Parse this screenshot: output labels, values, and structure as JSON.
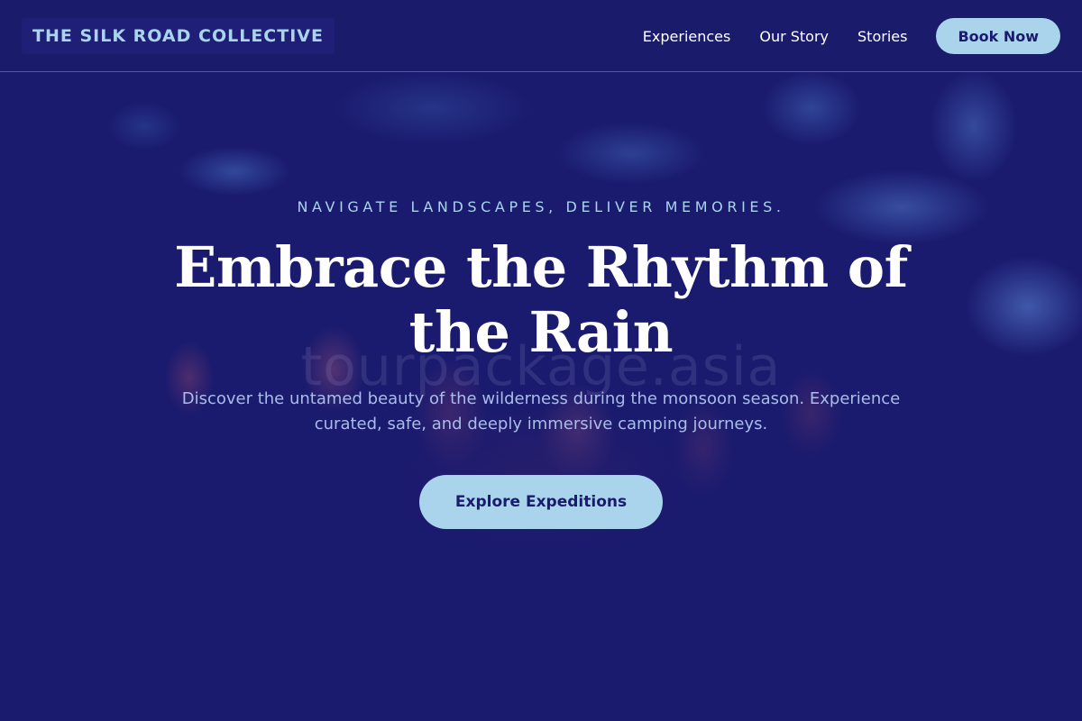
{
  "header": {
    "brand": "THE SILK ROAD COLLECTIVE",
    "nav": [
      "Experiences",
      "Our Story",
      "Stories"
    ],
    "book_label": "Book Now"
  },
  "hero": {
    "eyebrow": "NAVIGATE LANDSCAPES, DELIVER MEMORIES.",
    "headline": "Embrace the Rhythm of the Rain",
    "subtext": "Discover the untamed beauty of the wilderness during the monsoon season. Experience curated, safe, and deeply immersive camping journeys.",
    "cta_label": "Explore Expeditions",
    "watermark": "tourpackage.asia"
  },
  "colors": {
    "background": "#1a1a6e",
    "accent": "#a9d4ec",
    "text": "#ffffff",
    "muted_text": "#a9bde8"
  }
}
